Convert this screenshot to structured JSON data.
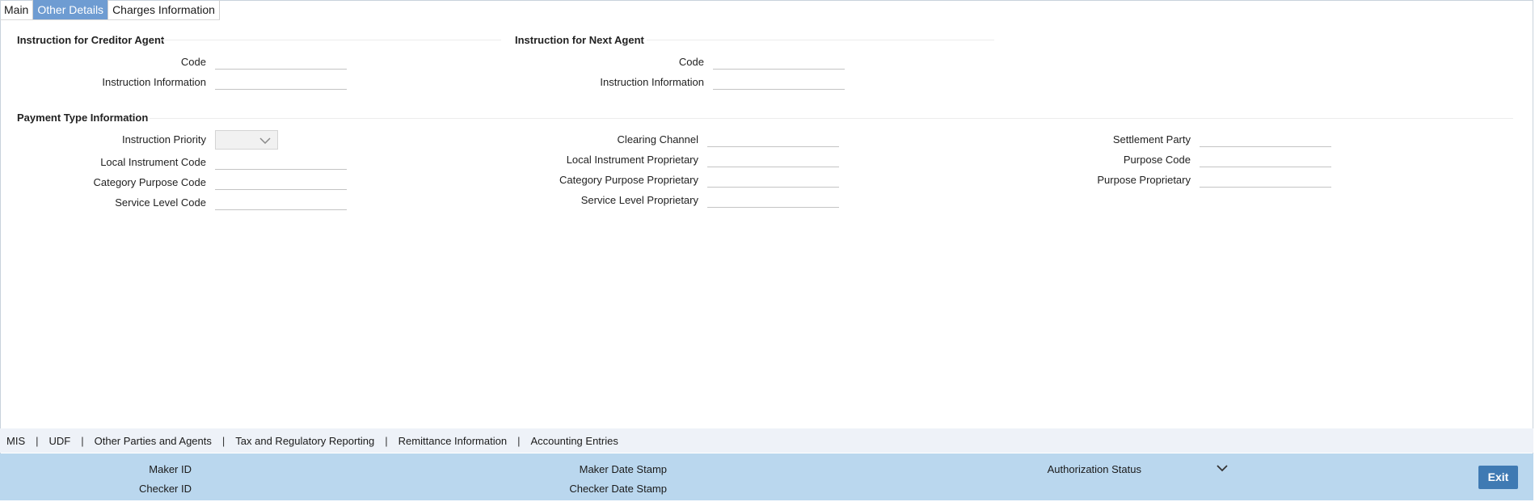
{
  "tabs": [
    {
      "label": "Main"
    },
    {
      "label": "Other Details"
    },
    {
      "label": "Charges Information"
    }
  ],
  "creditor_agent": {
    "title": "Instruction for Creditor Agent",
    "code_label": "Code",
    "code_value": "",
    "info_label": "Instruction Information",
    "info_value": ""
  },
  "next_agent": {
    "title": "Instruction for Next Agent",
    "code_label": "Code",
    "code_value": "",
    "info_label": "Instruction Information",
    "info_value": ""
  },
  "payment_type": {
    "title": "Payment Type Information",
    "instruction_priority_label": "Instruction Priority",
    "instruction_priority_value": "",
    "local_instrument_code_label": "Local Instrument Code",
    "category_purpose_code_label": "Category Purpose Code",
    "service_level_code_label": "Service Level Code",
    "clearing_channel_label": "Clearing Channel",
    "local_instrument_proprietary_label": "Local Instrument Proprietary",
    "category_purpose_proprietary_label": "Category Purpose Proprietary",
    "service_level_proprietary_label": "Service Level Proprietary",
    "settlement_party_label": "Settlement Party",
    "purpose_code_label": "Purpose Code",
    "purpose_proprietary_label": "Purpose Proprietary"
  },
  "links": [
    {
      "label": "MIS"
    },
    {
      "label": "UDF"
    },
    {
      "label": "Other Parties and Agents"
    },
    {
      "label": "Tax and Regulatory Reporting"
    },
    {
      "label": "Remittance Information"
    },
    {
      "label": "Accounting Entries"
    }
  ],
  "link_separator": "|",
  "footer": {
    "maker_id_label": "Maker ID",
    "checker_id_label": "Checker ID",
    "maker_date_stamp_label": "Maker Date Stamp",
    "checker_date_stamp_label": "Checker Date Stamp",
    "authorization_status_label": "Authorization Status",
    "exit_label": "Exit"
  },
  "colors": {
    "active_tab": "#6e9cd2",
    "footer_bg": "#bad7ee",
    "links_bar_bg": "#eef2f8",
    "exit_button": "#3f7ab3"
  },
  "icons": {
    "dropdown": "chevron-down-icon"
  }
}
